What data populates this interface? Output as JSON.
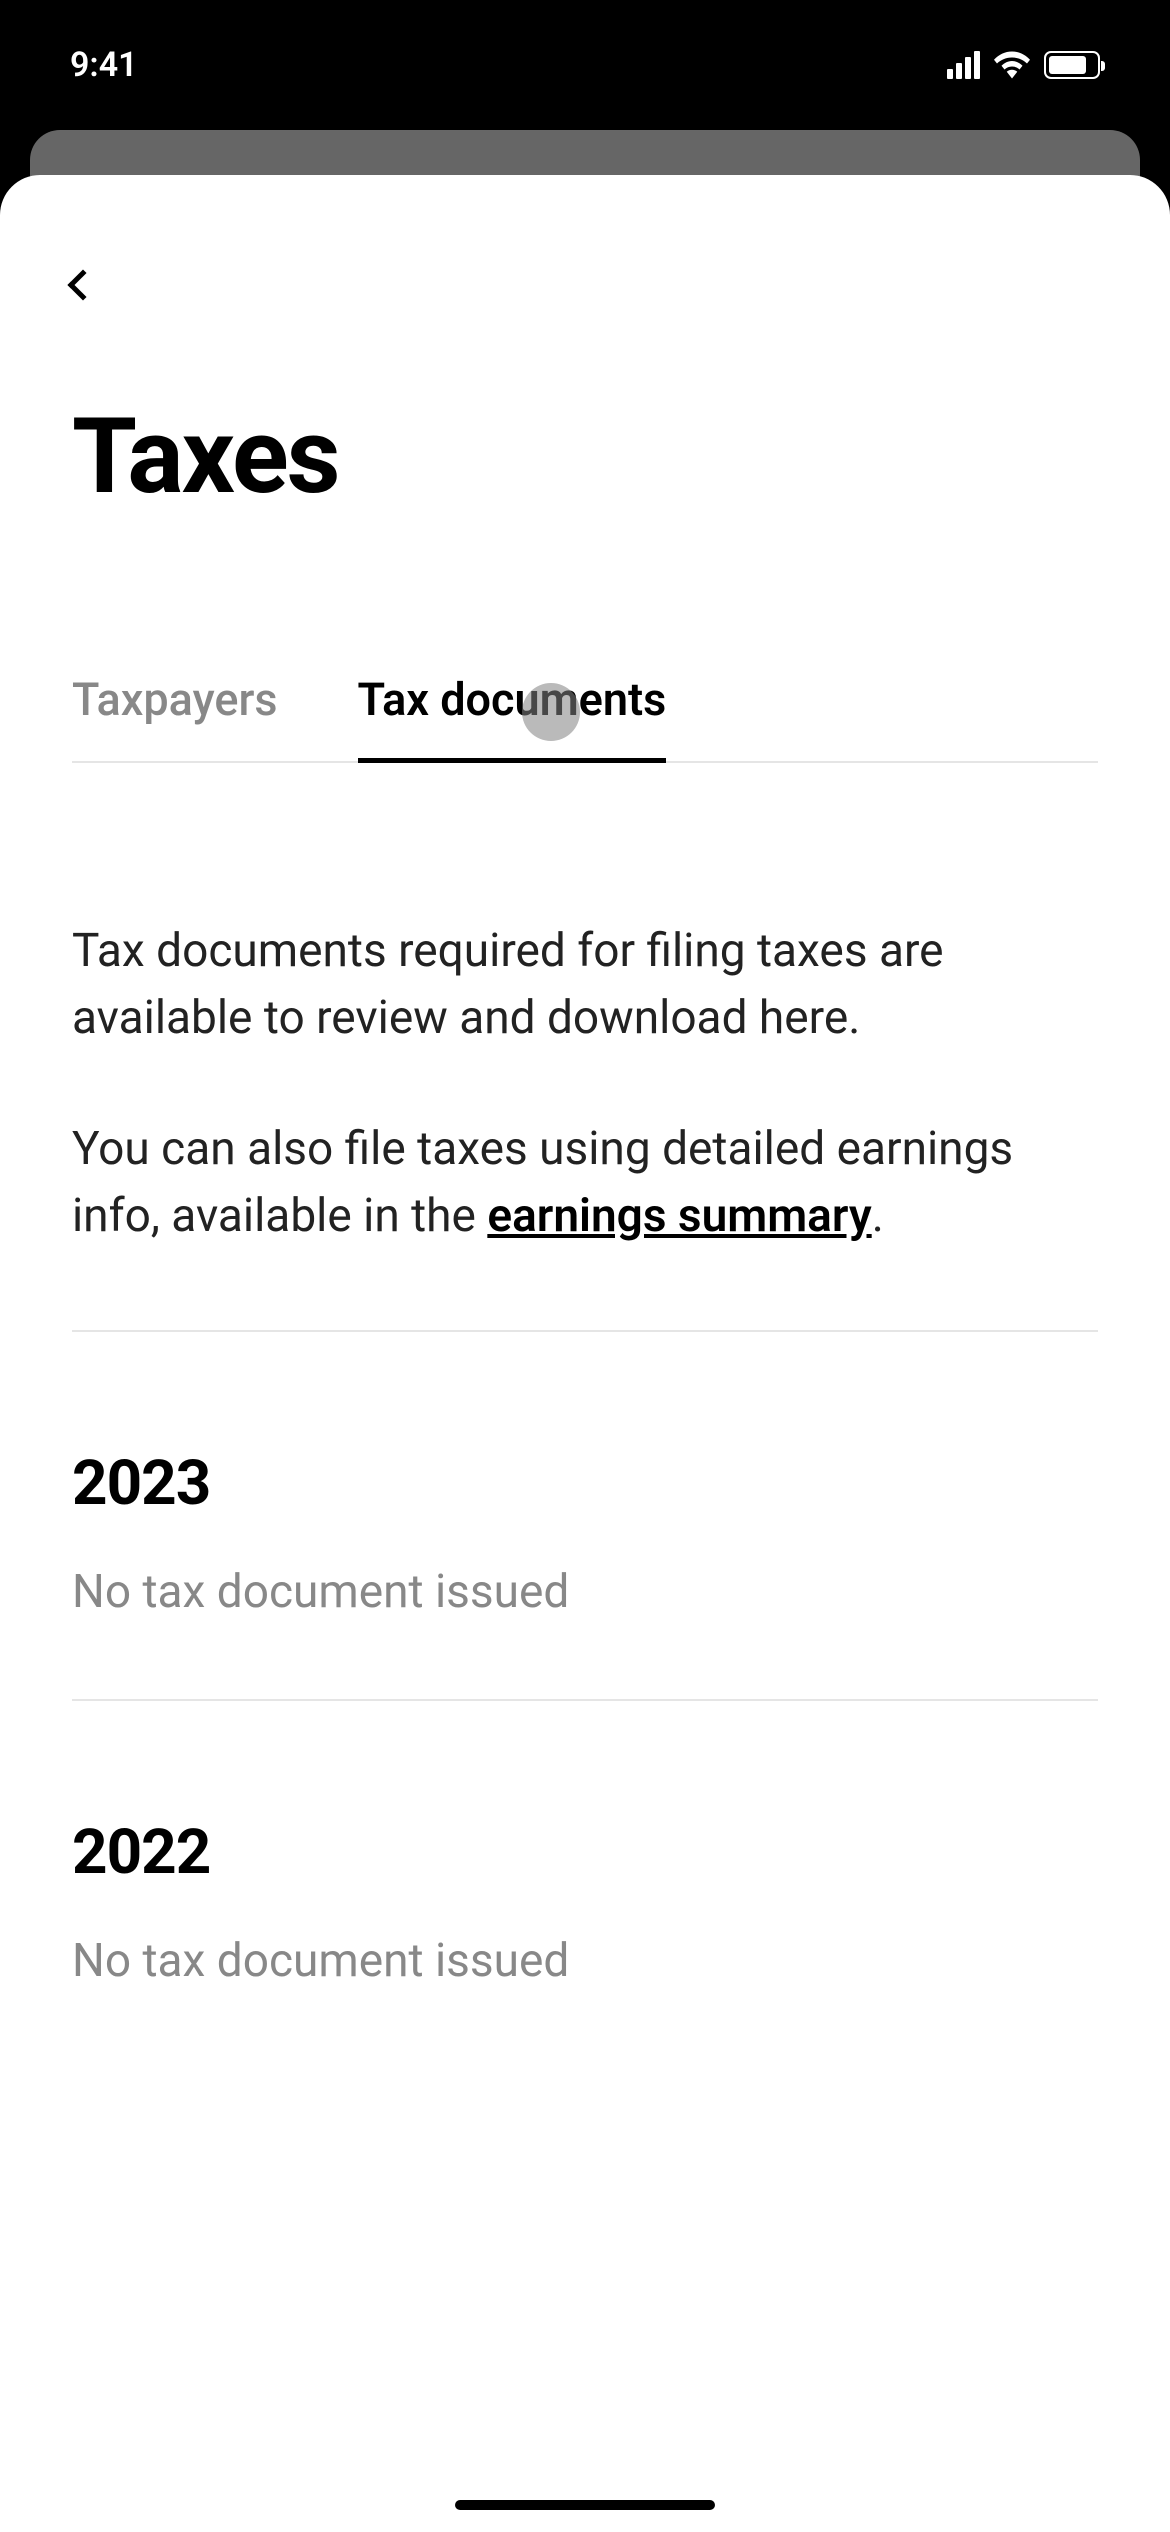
{
  "statusBar": {
    "time": "9:41"
  },
  "page": {
    "title": "Taxes"
  },
  "tabs": {
    "taxpayers": "Taxpayers",
    "taxDocuments": "Tax documents"
  },
  "description": {
    "line1": "Tax documents required for filing taxes are available to review and download here.",
    "line2a": "You can also file taxes using detailed earnings info, available in the ",
    "link": "earnings summary",
    "line2b": "."
  },
  "years": [
    {
      "year": "2023",
      "status": "No tax document issued"
    },
    {
      "year": "2022",
      "status": "No tax document issued"
    }
  ]
}
